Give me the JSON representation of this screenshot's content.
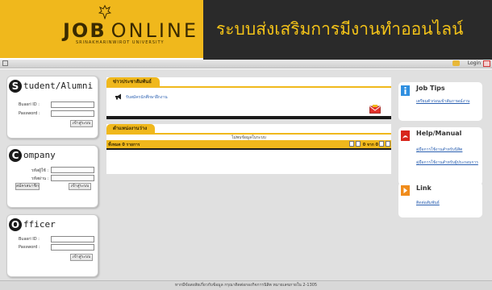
{
  "header": {
    "logo_word1": "JOB",
    "logo_word2": "ONLINE",
    "logo_sub": "SRINAKHARINWIROT UNIVERSITY",
    "title": "ระบบส่งเสริมการมีงานทำออนไลน์"
  },
  "topbar": {
    "login_label": "Login"
  },
  "student_box": {
    "letter": "S",
    "title": "tudent/Alumni",
    "id_label": "Buasri ID :",
    "password_label": "Password :",
    "submit_label": "เข้าสู่ระบบ",
    "id_value": "",
    "password_value": ""
  },
  "company_box": {
    "letter": "C",
    "title": "ompany",
    "user_label": "รหัสผู้ใช้ :",
    "pass_label": "รหัสผ่าน :",
    "register_label": "สมัครสมาชิก",
    "submit_label": "เข้าสู่ระบบ",
    "user_value": "",
    "pass_value": ""
  },
  "officer_box": {
    "letter": "O",
    "title": "fficer",
    "id_label": "Buasri ID :",
    "password_label": "Password :",
    "submit_label": "เข้าสู่ระบบ",
    "id_value": "",
    "password_value": ""
  },
  "news": {
    "tab_label": "ข่าวประชาสัมพันธ์",
    "item_text": "รับสมัครนักศึกษาฝึกงาน",
    "megaphone_icon": "megaphone-icon",
    "mail_icon": "mail-icon"
  },
  "jobs": {
    "tab_label": "ตำแหน่งงานว่าง",
    "empty_text": "ไม่พบข้อมูลในระบบ",
    "total_text": "ทั้งหมด 0 รายการ",
    "pager_text": "0 จาก 0"
  },
  "job_tips": {
    "title": "Job Tips",
    "link": "เตรียมตัวก่อนเข้าสัมภาษณ์งาน",
    "icon": "info-icon"
  },
  "help_manual": {
    "title": "Help/Manual",
    "link1": "คู่มือการใช้งานสำหรับนิสิต",
    "link2": "คู่มือการใช้งานสำหรับผู้ประกอบการ",
    "icon": "pdf-icon"
  },
  "link_box": {
    "title": "Link",
    "link": "ติดต่อสัมพันธ์",
    "icon": "arrow-icon"
  },
  "footer": {
    "text": "หากมีข้อสงสัยเกี่ยวกับข้อมูล กรุณาติดต่อกองกิจการนิสิต หมายเลขภายใน 2-1305"
  },
  "colors": {
    "accent": "#f0b81c",
    "header_bg": "#2a2a2a",
    "title": "#f4c318",
    "link": "#2a5fb0"
  }
}
